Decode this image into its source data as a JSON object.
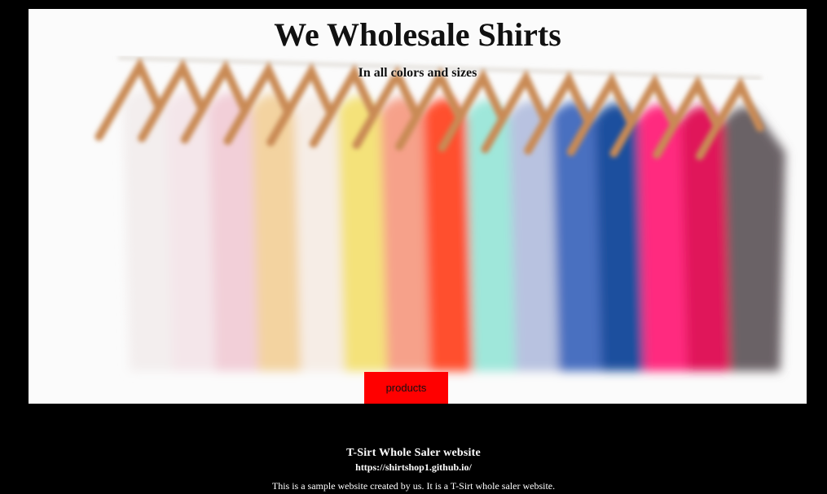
{
  "hero": {
    "title": "We Wholesale Shirts",
    "subtitle": "In all colors and sizes",
    "image": "shirts-on-hangers-photo",
    "shirt_colors": [
      "#f3eeee",
      "#f4e6ea",
      "#f2cfd8",
      "#f3d3a0",
      "#f6ede6",
      "#f4e27a",
      "#f6a18a",
      "#ff4f2e",
      "#9fe7da",
      "#b8c2e0",
      "#4a6fc0",
      "#1f4f9e",
      "#ff2a7f",
      "#e0185a",
      "#6a6266"
    ]
  },
  "cta": {
    "label": "products",
    "color": "#ff0000"
  },
  "footer": {
    "title": "T-Sirt Whole Saler website",
    "link": "https://shirtshop1.github.io/",
    "description": "This is a sample website created by us. It is a T-Sirt whole saler website."
  },
  "colors": {
    "page_background": "#000000",
    "hero_background": "#fbfbfb"
  }
}
